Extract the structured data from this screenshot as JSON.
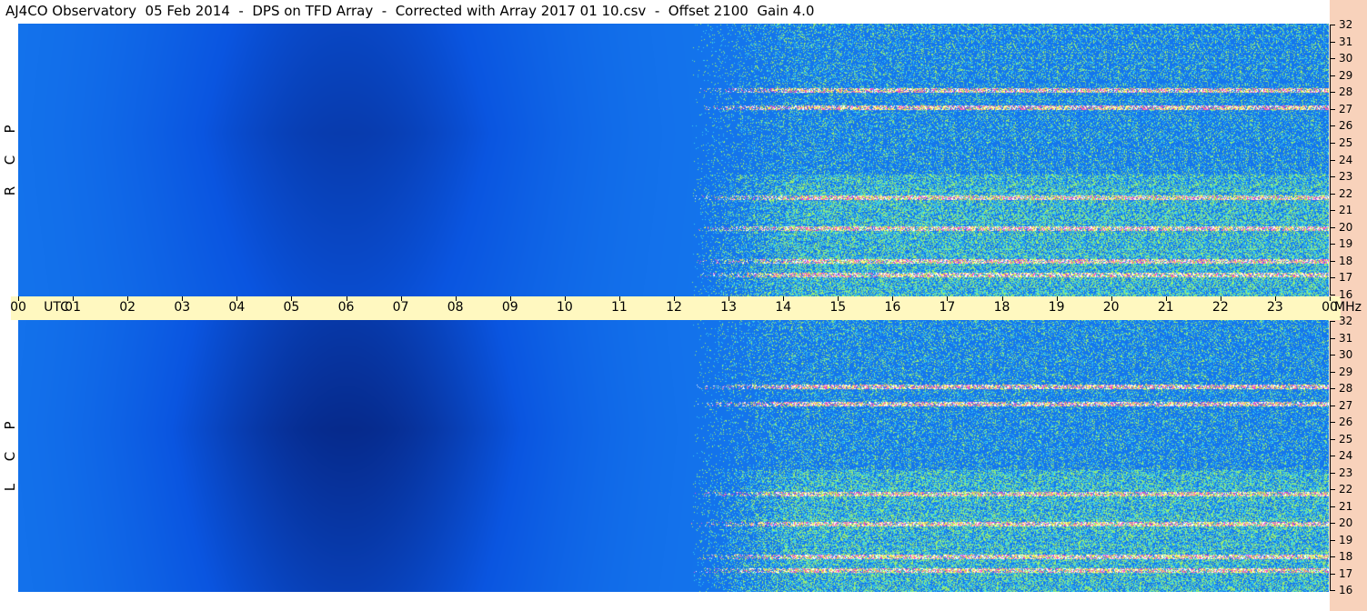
{
  "title": "AJ4CO Observatory  05 Feb 2014  -  DPS on TFD Array  -  Corrected with Array 2017 01 10.csv  -  Offset 2100  Gain 4.0",
  "colors": {
    "background_deep": "#062a8c",
    "background_mid": "#0a55e0",
    "background_light": "#1b8cf5",
    "noise_cyan": "#3ccfe8",
    "noise_green": "#9df06b",
    "noise_yellow": "#f5f04a",
    "noise_magenta": "#f050c8",
    "noise_white": "#ffffff",
    "utc_band": "#fff8c0",
    "freq_strip": "#f8d2bb"
  },
  "chart_data": {
    "type": "heatmap",
    "description_panels": [
      {
        "name": "R C P",
        "label_chars": [
          "P",
          "C",
          "R"
        ],
        "y_range_mhz": [
          16,
          32
        ],
        "yticks": [
          "32",
          "31",
          "30",
          "29",
          "28",
          "27",
          "26",
          "25",
          "24",
          "23",
          "22",
          "21",
          "20",
          "19",
          "18",
          "17",
          "16"
        ],
        "activity_onset_utc": 12.3,
        "bands_mhz": [
          17.3,
          18.1,
          20.0,
          21.8,
          27.1,
          28.1
        ]
      },
      {
        "name": "L C P",
        "label_chars": [
          "P",
          "C",
          "L"
        ],
        "y_range_mhz": [
          16,
          32
        ],
        "yticks": [
          "32",
          "31",
          "30",
          "29",
          "28",
          "27",
          "26",
          "25",
          "24",
          "23",
          "22",
          "21",
          "20",
          "19",
          "18",
          "17",
          "16"
        ],
        "activity_onset_utc": 12.3,
        "bands_mhz": [
          17.3,
          18.1,
          20.0,
          21.8,
          27.1,
          28.1
        ]
      }
    ],
    "x_axis": {
      "range_utc": [
        0,
        24
      ],
      "ticks": [
        "00",
        "01",
        "02",
        "03",
        "04",
        "05",
        "06",
        "07",
        "08",
        "09",
        "10",
        "11",
        "12",
        "13",
        "14",
        "15",
        "16",
        "17",
        "18",
        "19",
        "20",
        "21",
        "22",
        "23",
        "00"
      ],
      "utc_label": "UTC",
      "mhz_label": "MHz"
    }
  }
}
